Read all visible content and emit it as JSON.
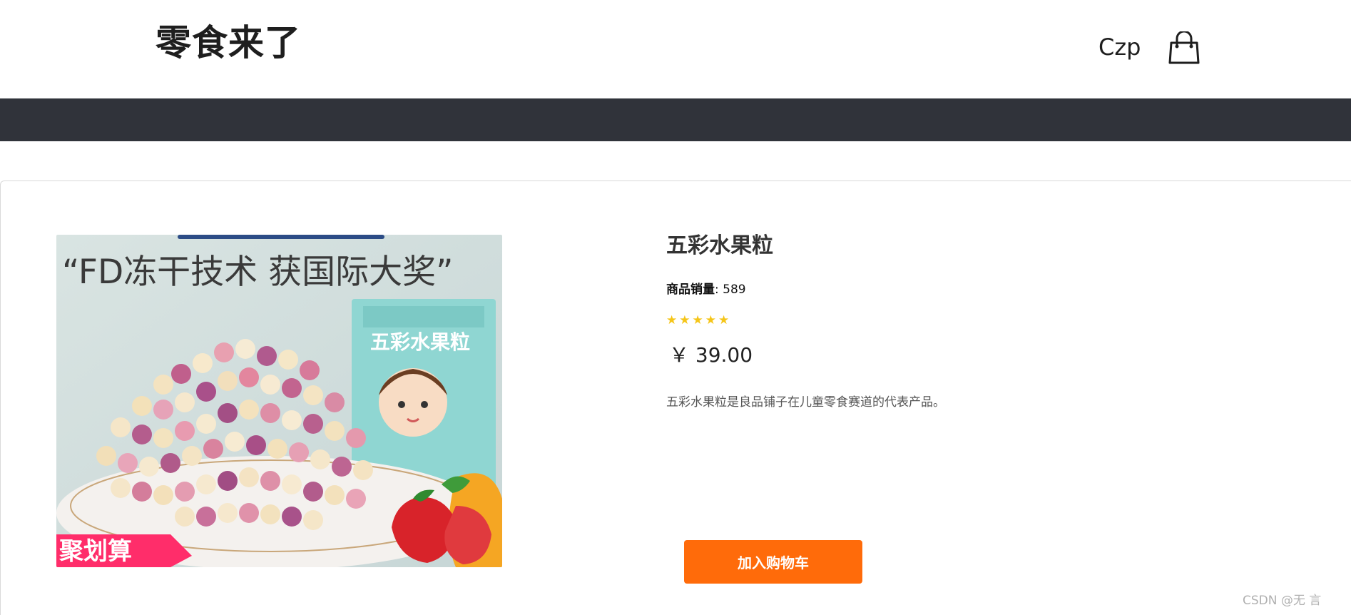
{
  "header": {
    "logo_text": "零食来了",
    "username": "Czp",
    "cart_icon": "shopping-bag-icon"
  },
  "product": {
    "image_banner_text": "“FD冻干技术 获国际大奖”",
    "image_promo_tag": "聚划算",
    "title": "五彩水果粒",
    "sales_label": "商品销量",
    "sales_sep": ": ",
    "sales_value": "589",
    "rating_stars": "★★★★★",
    "rating": 5,
    "price": "￥ 39.00",
    "description": "五彩水果粒是良品铺子在儿童零食赛道的代表产品。",
    "add_to_cart_label": "加入购物车"
  },
  "footer": {
    "watermark": "CSDN @无  言"
  },
  "colors": {
    "navbar": "#30333a",
    "accent": "#ff6b0a",
    "stars": "#f5c518"
  }
}
